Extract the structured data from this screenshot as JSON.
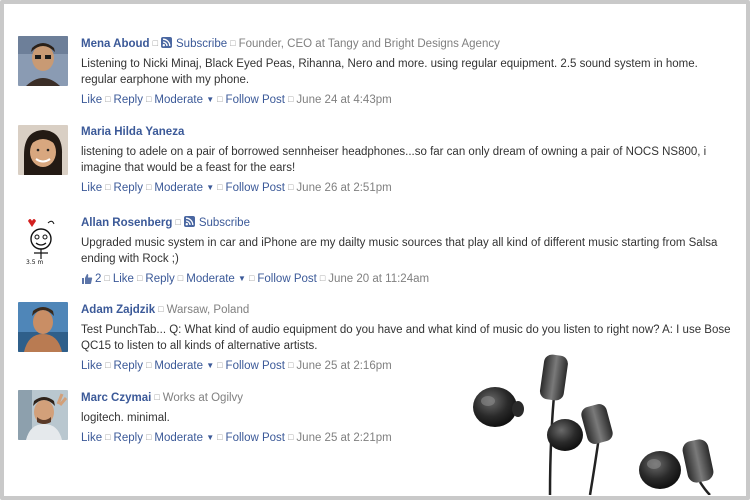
{
  "comments": [
    {
      "name": "Mena Aboud",
      "subscribe_label": "Subscribe",
      "info": "Founder, CEO at Tangy and Bright Designs Agency",
      "text": "Listening to Nicki Minaj, Black Eyed Peas, Rihanna, Nero and more. using regular equipment. 2.5 sound system in home. regular earphone with my phone.",
      "like": "Like",
      "reply": "Reply",
      "moderate": "Moderate",
      "follow": "Follow Post",
      "time": "June 24 at 4:43pm"
    },
    {
      "name": "Maria Hilda Yaneza",
      "text": "listening to adele on a pair of borrowed sennheiser headphones...so far can only dream of owning a pair of NOCS NS800, i imagine that would be a feast for the ears!",
      "like": "Like",
      "reply": "Reply",
      "moderate": "Moderate",
      "follow": "Follow Post",
      "time": "June 26 at 2:51pm"
    },
    {
      "name": "Allan Rosenberg",
      "subscribe_label": "Subscribe",
      "text": "Upgraded music system in car and iPhone are my dailty music sources that play all kind of different music starting from Salsa ending with Rock ;)",
      "like_count": "2",
      "like": "Like",
      "reply": "Reply",
      "moderate": "Moderate",
      "follow": "Follow Post",
      "time": "June 20 at 11:24am"
    },
    {
      "name": "Adam Zajdzik",
      "info": "Warsaw, Poland",
      "text": "Test PunchTab... Q: What kind of audio equipment do you have and what kind of music do you listen to right now? A: I use Bose QC15 to listen to all kinds of alternative artists.",
      "like": "Like",
      "reply": "Reply",
      "moderate": "Moderate",
      "follow": "Follow Post",
      "time": "June 25 at 2:16pm"
    },
    {
      "name": "Marc Czymai",
      "info": "Works at Ogilvy",
      "text": "logitech. minimal.",
      "like": "Like",
      "reply": "Reply",
      "moderate": "Moderate",
      "follow": "Follow Post",
      "time": "June 25 at 2:21pm"
    }
  ],
  "colors": {
    "link": "#3b5998",
    "meta": "#808080",
    "text": "#333333",
    "frame": "#c9c9c9"
  },
  "icons": [
    "rss-icon",
    "dropdown-caret-icon",
    "thumbs-up-icon"
  ]
}
